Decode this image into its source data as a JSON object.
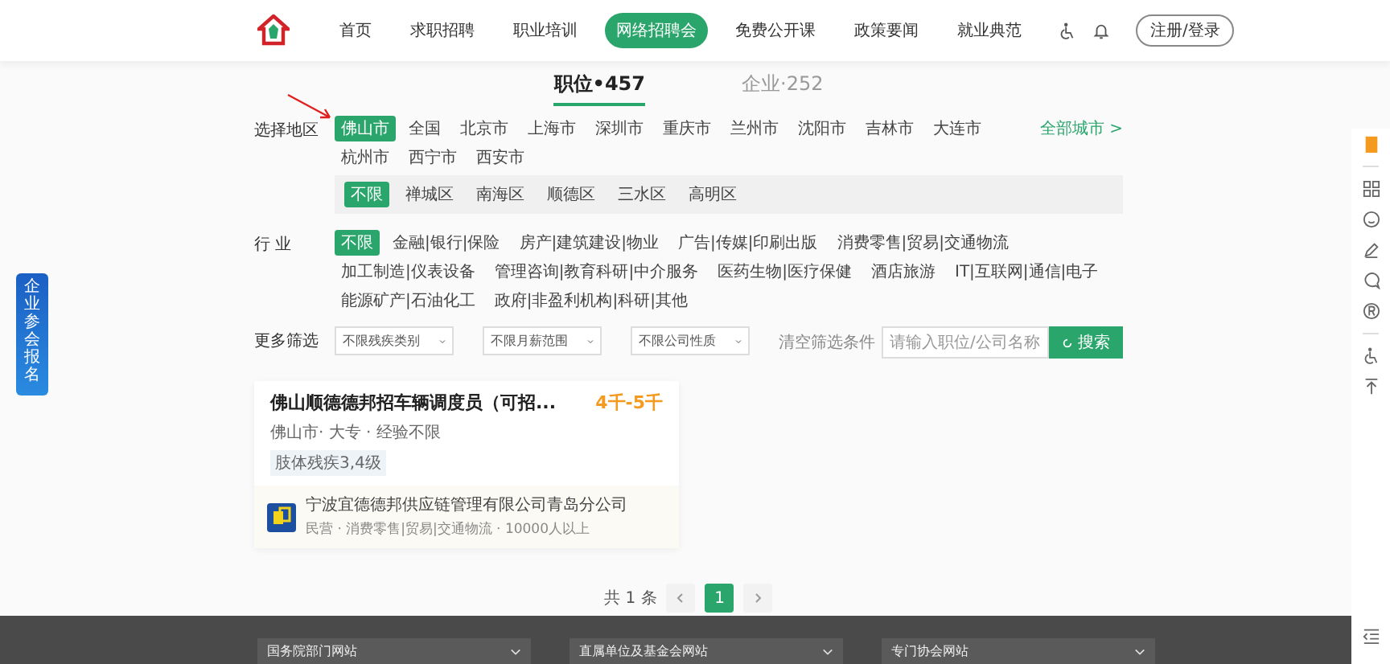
{
  "header": {
    "nav": [
      {
        "label": "首页",
        "selected": false
      },
      {
        "label": "求职招聘",
        "selected": false
      },
      {
        "label": "职业培训",
        "selected": false
      },
      {
        "label": "网络招聘会",
        "selected": true
      },
      {
        "label": "免费公开课",
        "selected": false
      },
      {
        "label": "政策要闻",
        "selected": false
      },
      {
        "label": "就业典范",
        "selected": false
      }
    ],
    "login_button": "注册/登录"
  },
  "tabs": [
    {
      "label": "职位•457",
      "selected": true
    },
    {
      "label": "企业·252",
      "selected": false
    }
  ],
  "region": {
    "label": "选择地区",
    "cities": [
      {
        "label": "佛山市",
        "selected": true
      },
      {
        "label": "全国",
        "selected": false
      },
      {
        "label": "北京市",
        "selected": false
      },
      {
        "label": "上海市",
        "selected": false
      },
      {
        "label": "深圳市",
        "selected": false
      },
      {
        "label": "重庆市",
        "selected": false
      },
      {
        "label": "兰州市",
        "selected": false
      },
      {
        "label": "沈阳市",
        "selected": false
      },
      {
        "label": "吉林市",
        "selected": false
      },
      {
        "label": "大连市",
        "selected": false
      },
      {
        "label": "杭州市",
        "selected": false
      },
      {
        "label": "西宁市",
        "selected": false
      },
      {
        "label": "西安市",
        "selected": false
      }
    ],
    "all_cities_link": "全部城市 >",
    "districts": [
      {
        "label": "不限",
        "selected": true
      },
      {
        "label": "禅城区",
        "selected": false
      },
      {
        "label": "南海区",
        "selected": false
      },
      {
        "label": "顺德区",
        "selected": false
      },
      {
        "label": "三水区",
        "selected": false
      },
      {
        "label": "高明区",
        "selected": false
      }
    ]
  },
  "industry": {
    "label": "行 业",
    "options": [
      {
        "label": "不限",
        "selected": true
      },
      {
        "label": "金融|银行|保险",
        "selected": false
      },
      {
        "label": "房产|建筑建设|物业",
        "selected": false
      },
      {
        "label": "广告|传媒|印刷出版",
        "selected": false
      },
      {
        "label": "消费零售|贸易|交通物流",
        "selected": false
      },
      {
        "label": "加工制造|仪表设备",
        "selected": false
      },
      {
        "label": "管理咨询|教育科研|中介服务",
        "selected": false
      },
      {
        "label": "医药生物|医疗保健",
        "selected": false
      },
      {
        "label": "酒店旅游",
        "selected": false
      },
      {
        "label": "IT|互联网|通信|电子",
        "selected": false
      },
      {
        "label": "能源矿产|石油化工",
        "selected": false
      },
      {
        "label": "政府|非盈利机构|科研|其他",
        "selected": false
      }
    ]
  },
  "more_filters": {
    "label": "更多筛选",
    "selects": [
      "不限残疾类别",
      "不限月薪范围",
      "不限公司性质"
    ],
    "clear_link": "清空筛选条件",
    "search": {
      "placeholder": "请输入职位/公司名称"
    },
    "search_button": "搜索"
  },
  "jobs": [
    {
      "title": "佛山顺德德邦招车辆调度员（可招...",
      "salary": "4千-5千",
      "meta": "佛山市· 大专 · 经验不限",
      "tag": "肢体残疾3,4级",
      "company": "宁波宜德德邦供应链管理有限公司青岛分公司",
      "company_info": "民营 · 消费零售|贸易|交通物流 · 10000人以上"
    }
  ],
  "pagination": {
    "total": "共 1 条",
    "pages": [
      {
        "label": "1",
        "selected": true
      }
    ]
  },
  "footer": {
    "links": [
      "国务院部门网站",
      "直属单位及基金会网站",
      "专门协会网站"
    ]
  },
  "side_banner": "企业参会报名"
}
